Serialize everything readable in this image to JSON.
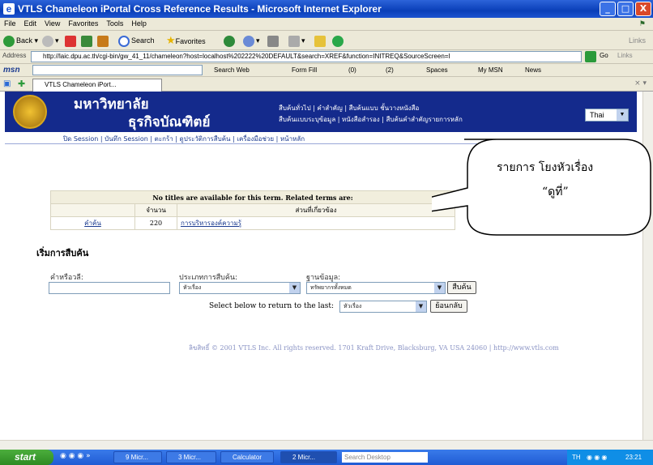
{
  "window": {
    "title": "VTLS Chameleon iPortal Cross Reference Results - Microsoft Internet Explorer",
    "min": "_",
    "max": "□",
    "close": "X"
  },
  "menu": [
    "File",
    "Edit",
    "View",
    "Favorites",
    "Tools",
    "Help"
  ],
  "toolbar": {
    "back": "Back",
    "search": "Search",
    "favorites": "Favorites",
    "links": "Links"
  },
  "address": {
    "label": "Address",
    "url": "http://laic.dpu.ac.th/cgi-bin/gw_41_11/chameleon?host=localhost%202222%20DEFAULT&search=XREF&function=INITREQ&SourceScreen=I",
    "go": "Go"
  },
  "msn": {
    "logo": "msn",
    "search_web": "Search Web",
    "form_fill": "Form Fill",
    "mail": "(0)",
    "messenger": "(2)",
    "spaces": "Spaces",
    "my_msn": "My MSN",
    "news": "News"
  },
  "tab": {
    "label": "VTLS Chameleon iPort..."
  },
  "banner": {
    "uni_line1": "มหาวิทยาลัย",
    "uni_line2": "ธุรกิจบัณฑิตย์",
    "links_row1": "สืบค้นทั่วไป | คำสำคัญ | สืบค้นแบบ ชั้นวางหนังสือ",
    "links_row2": "สืบค้นแบบระบุข้อมูล | หนังสือสำรอง | สืบค้นคำสำคัญรายการหลัก",
    "language": "Thai"
  },
  "nav": "ปิด Session | บันทึก Session | ตะกร้า | ดูประวัติการสืบค้น | เครื่องมือช่วย | หน้าหลัก",
  "xref": {
    "notice": "No titles are available for this term. Related terms are:",
    "col_count": "จำนวน",
    "col_related": "ส่วนที่เกี่ยวข้อง",
    "row_label": "คำค้น",
    "row_count": "220",
    "row_term": "การบริหารองค์ความรู้"
  },
  "search": {
    "heading": "เริ่มการสืบค้น",
    "term_label": "คำหรือวลี:",
    "term_value": "",
    "type_label": "ประเภทการสืบค้น:",
    "type_value": "หัวเรื่อง",
    "db_label": "ฐานข้อมูล:",
    "db_value": "ทรัพยากรทั้งหมด",
    "submit": "สืบค้น",
    "return_label": "Select below to return to the last:",
    "return_value": "หัวเรื่อง",
    "back_button": "ย้อนกลับ"
  },
  "copyright": "ลิขสิทธิ์ © 2001 VTLS Inc. All rights reserved. 1701 Kraft Drive, Blacksburg, VA USA 24060 | http://www.vtls.com",
  "callout": {
    "line1": "รายการ โยงหัวเรื่อง",
    "line2": "“ดูที่”"
  },
  "taskbar": {
    "start": "start",
    "tasks": [
      "9 Micr...",
      "3 Micr...",
      "Calculator",
      "2 Micr..."
    ],
    "search": "Search Desktop",
    "lang": "TH",
    "time": "23:21"
  },
  "colors": {
    "banner_blue": "#142a8c",
    "link": "#1a3a8f",
    "titlebar": "#0a3fb8"
  }
}
